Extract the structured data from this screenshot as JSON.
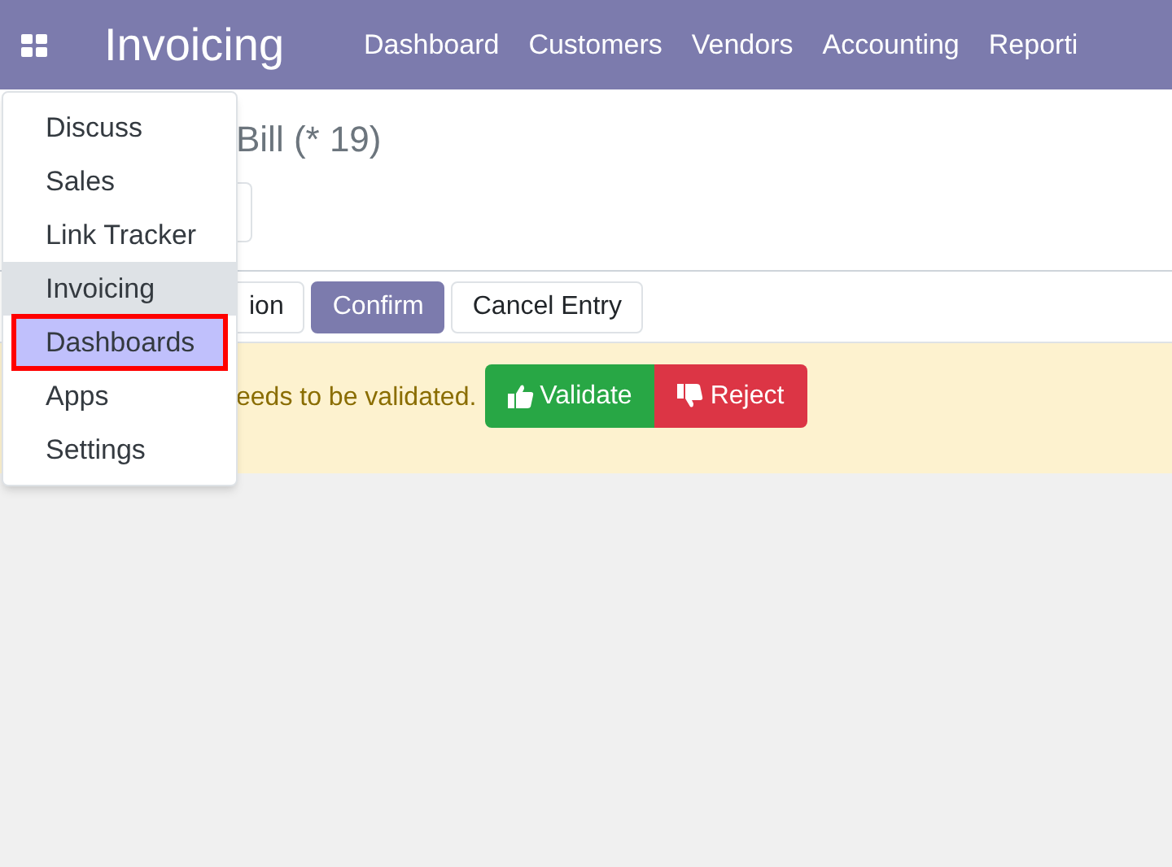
{
  "navbar": {
    "app_title": "Invoicing",
    "menu": [
      "Dashboard",
      "Customers",
      "Vendors",
      "Accounting",
      "Reporti"
    ]
  },
  "breadcrumb": "Bill (* 19)",
  "action_buttons": [
    {
      "label": "ion",
      "kind": "plain"
    },
    {
      "label": "Confirm",
      "kind": "primary"
    },
    {
      "label": "Cancel Entry",
      "kind": "plain"
    }
  ],
  "alert": {
    "message": "eeds to be validated.",
    "buttons": [
      {
        "label": "Validate",
        "kind": "approve"
      },
      {
        "label": "Reject",
        "kind": "reject"
      }
    ]
  },
  "app_menu": {
    "items": [
      {
        "label": "Discuss",
        "selected": false,
        "hovered": false,
        "outlined": false
      },
      {
        "label": "Sales",
        "selected": false,
        "hovered": false,
        "outlined": false
      },
      {
        "label": "Link Tracker",
        "selected": false,
        "hovered": false,
        "outlined": false
      },
      {
        "label": "Invoicing",
        "selected": true,
        "hovered": false,
        "outlined": false
      },
      {
        "label": "Dashboards",
        "selected": false,
        "hovered": true,
        "outlined": true
      },
      {
        "label": "Apps",
        "selected": false,
        "hovered": false,
        "outlined": false
      },
      {
        "label": "Settings",
        "selected": false,
        "hovered": false,
        "outlined": false
      }
    ]
  }
}
